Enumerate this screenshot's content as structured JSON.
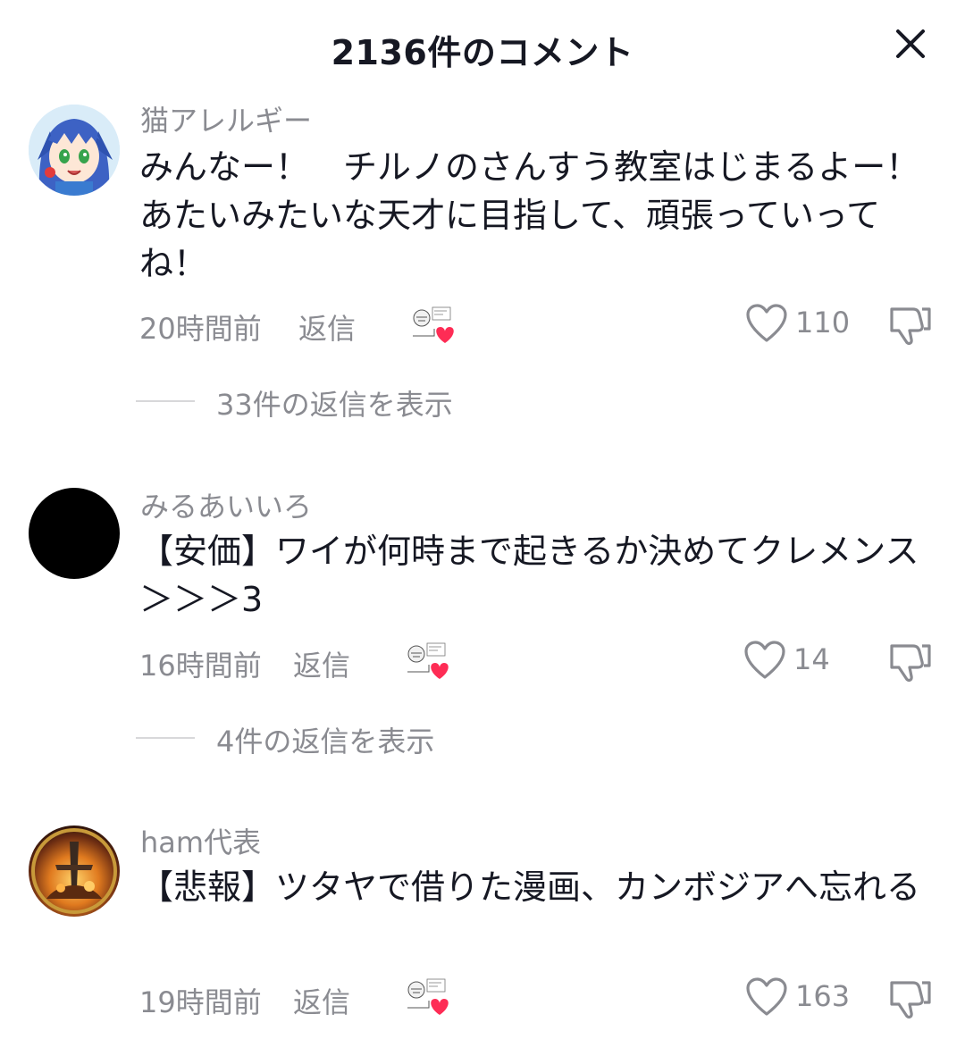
{
  "header": {
    "title": "2136件のコメント",
    "close_icon": "close-icon"
  },
  "comments": [
    {
      "username": "猫アレルギー",
      "text": "みんなー！　チルノのさんすう教室はじまるよー！　あたいみたいな天才に目指して、頑張っていってね！",
      "time": "20時間前",
      "reply_label": "返信",
      "likes": "110",
      "view_replies": "33件の返信を表示",
      "avatar": "anime-girl-avatar"
    },
    {
      "username": "みるあいいろ",
      "text": "【安価】ワイが何時まで起きるか決めてクレメンス ＞＞＞3",
      "time": "16時間前",
      "reply_label": "返信",
      "likes": "14",
      "view_replies": "4件の返信を表示",
      "avatar": "black-circle-avatar"
    },
    {
      "username": "ham代表",
      "text": "【悲報】ツタヤで借りた漫画、カンボジアへ忘れる",
      "time": "19時間前",
      "reply_label": "返信",
      "likes": "163",
      "avatar": "fiery-scene-avatar"
    }
  ],
  "colors": {
    "primary_text": "#161823",
    "secondary_text": "#8a8b91",
    "divider": "#d8d8da",
    "heart_sticker": "#fe2c55"
  }
}
